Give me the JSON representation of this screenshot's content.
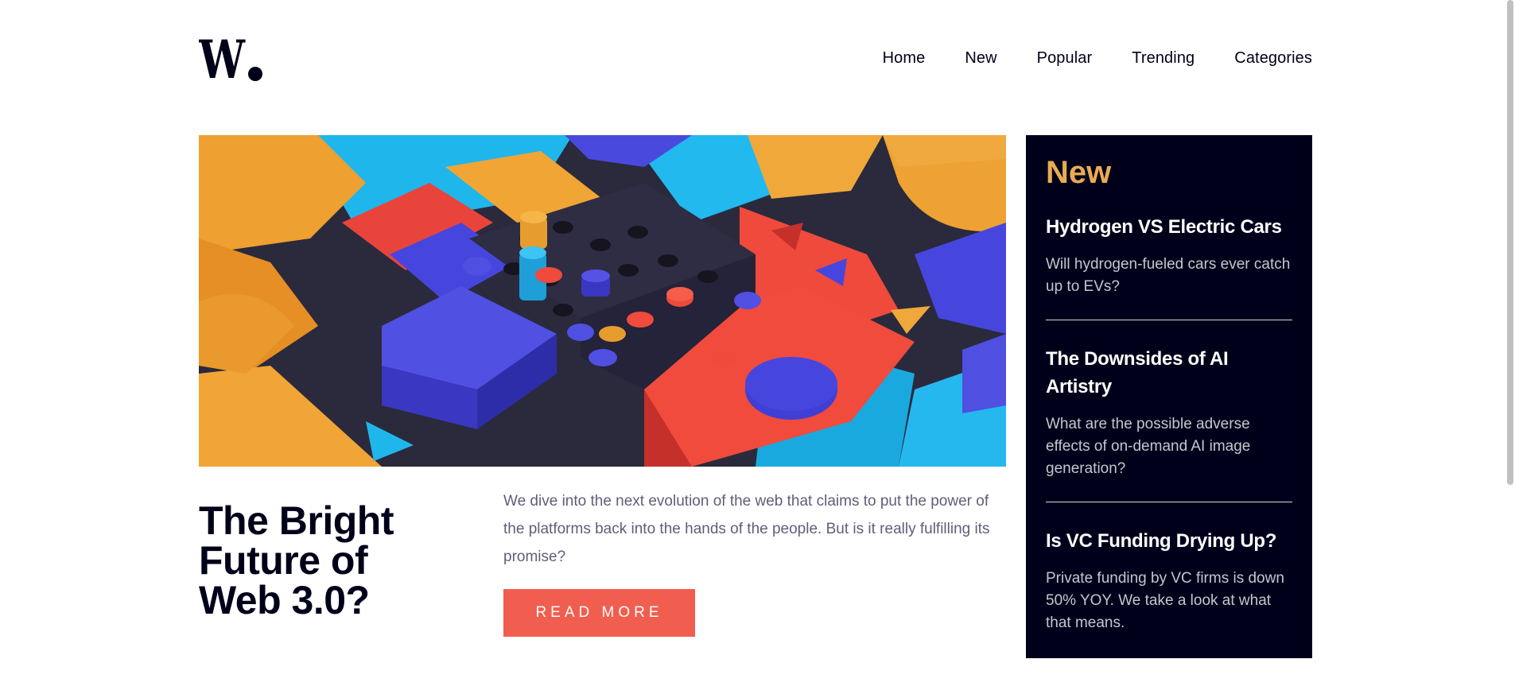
{
  "brand": {
    "logo_text": "W.",
    "icon": "logo-icon"
  },
  "nav": {
    "items": [
      {
        "label": "Home"
      },
      {
        "label": "New"
      },
      {
        "label": "Popular"
      },
      {
        "label": "Trending"
      },
      {
        "label": "Categories"
      }
    ]
  },
  "hero": {
    "image_description_icon": "abstract-blocks-image",
    "title": "The Bright Future of Web 3.0?",
    "description": "We dive into the next evolution of the web that claims to put the power of the platforms back into the hands of the people. But is it really fulfilling its promise?",
    "cta_label": "READ MORE"
  },
  "new_panel": {
    "heading": "New",
    "items": [
      {
        "title": "Hydrogen VS Electric Cars",
        "text": "Will hydrogen-fueled cars ever catch up to EVs?"
      },
      {
        "title": "The Downsides of AI Artistry",
        "text": "What are the possible adverse effects of on-demand AI image generation?"
      },
      {
        "title": "Is VC Funding Drying Up?",
        "text": "Private funding by VC firms is down 50% YOY. We take a look at what that means."
      }
    ]
  },
  "colors": {
    "accent": "#f15e50",
    "panel_bg": "#00001a",
    "panel_heading": "#e9ab53",
    "text_dark": "#00001a",
    "text_muted": "#5d5f79"
  }
}
